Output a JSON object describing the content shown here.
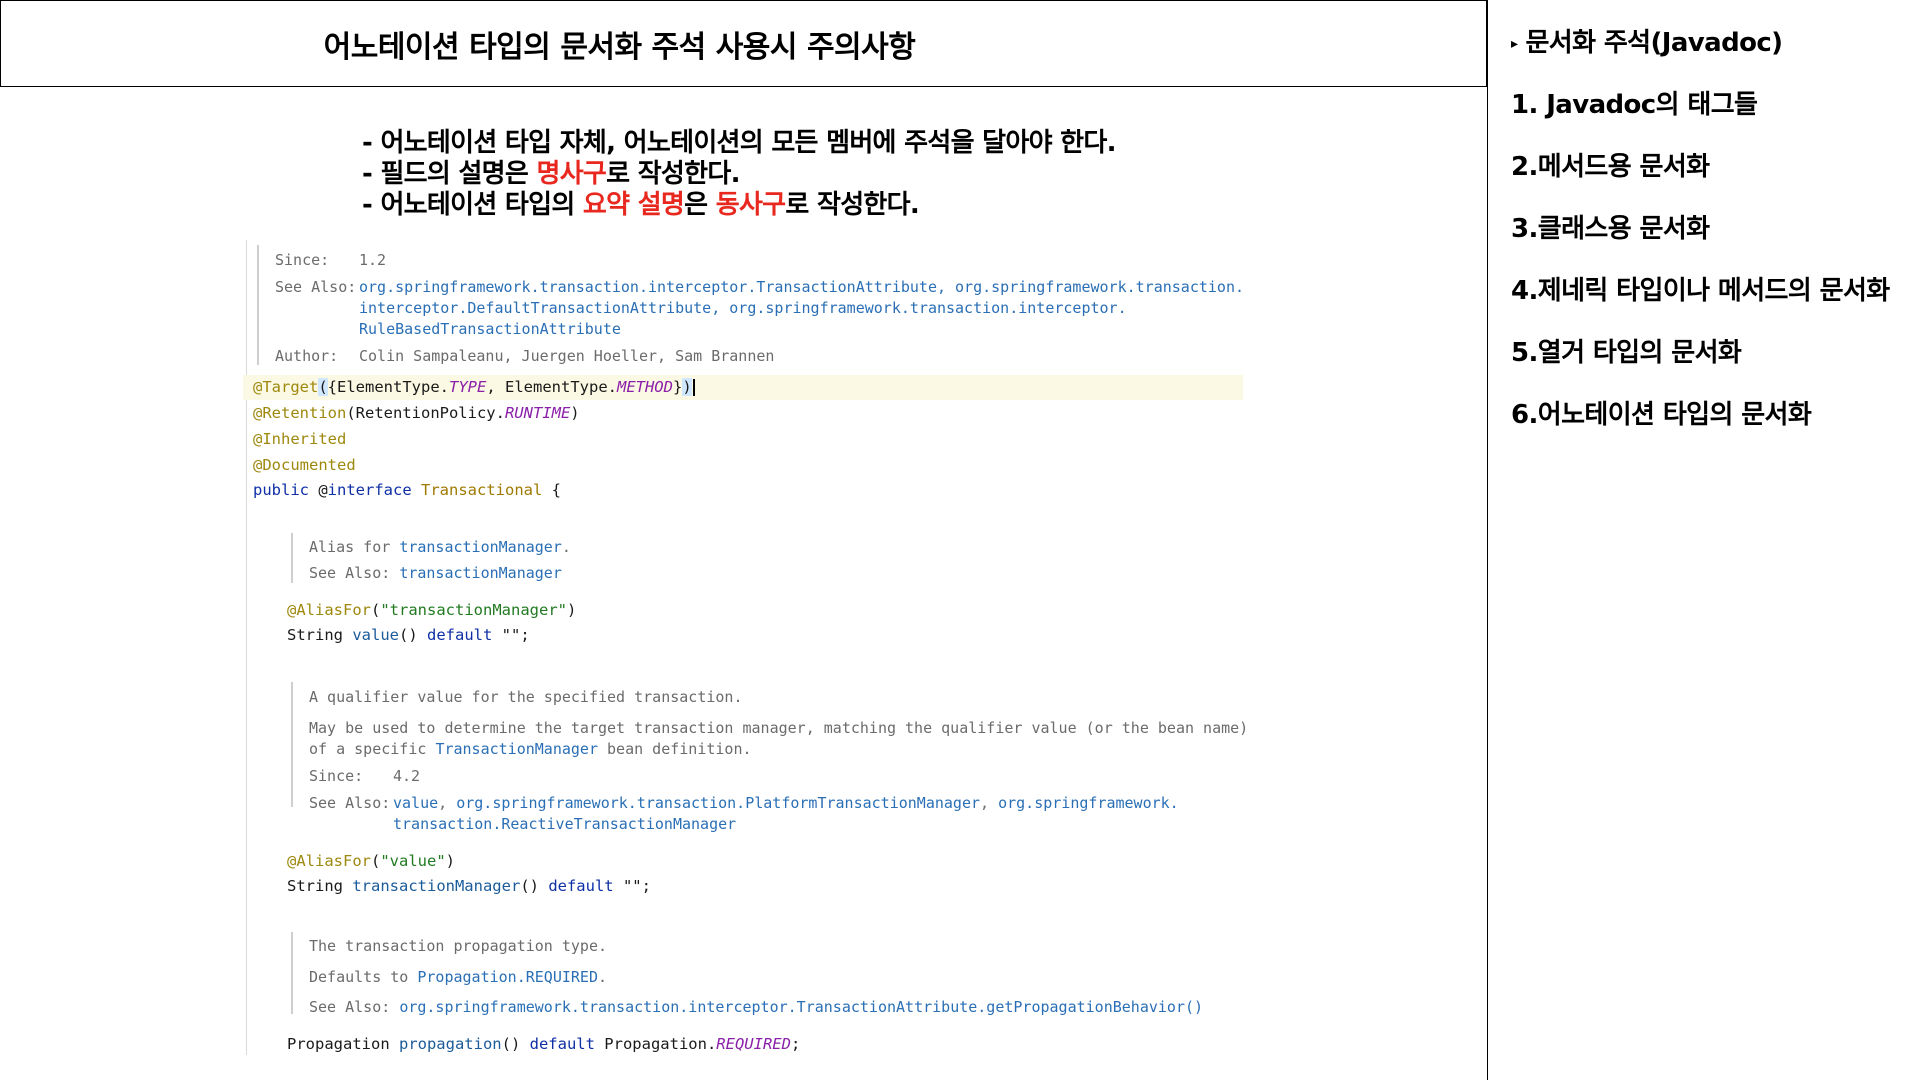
{
  "title": "어노테이션 타입의 문서화 주석 사용시 주의사항",
  "sidebar": {
    "items": [
      {
        "bullet": "▸",
        "label": "문서화 주석(Javadoc)"
      },
      {
        "label": "1. Javadoc의 태그들"
      },
      {
        "label": "2.메서드용 문서화"
      },
      {
        "label": "3.클래스용 문서화"
      },
      {
        "label": "4.제네릭 타입이나 메서드의 문서화"
      },
      {
        "label": "5.열거 타입의 문서화"
      },
      {
        "label": "6.어노테이션 타입의 문서화"
      }
    ]
  },
  "notes": {
    "line1": "- 어노테이션 타입 자체, 어노테이션의 모든 멤버에 주석을 달아야 한다.",
    "line2_a": "- 필드의 설명은 ",
    "line2_b": "명사구",
    "line2_c": "로 작성한다.",
    "line3_a": "- 어노테이션 타입의 ",
    "line3_b": "요약 설명",
    "line3_c": "은 ",
    "line3_d": "동사구",
    "line3_e": "로 작성한다.",
    "accent_color": "#e8281e"
  },
  "code": {
    "top_doc": {
      "since_label": "Since:",
      "since_value": "1.2",
      "see_label": "See Also:",
      "see_line1": "org.springframework.transaction.interceptor.TransactionAttribute, org.springframework.transaction.",
      "see_line2": "interceptor.DefaultTransactionAttribute, org.springframework.transaction.interceptor.",
      "see_line3": "RuleBasedTransactionAttribute",
      "author_label": "Author:",
      "author_value": "Colin Sampaleanu, Juergen Hoeller, Sam Brannen"
    },
    "target": {
      "anno": "@Target",
      "open": "(",
      "brace_open": "{",
      "et1": "ElementType.",
      "c1": "TYPE",
      "sep": ", ",
      "et2": "ElementType.",
      "c2": "METHOD",
      "brace_close": "}",
      "close": ")"
    },
    "retention": {
      "anno": "@Retention",
      "pre": "(RetentionPolicy.",
      "c": "RUNTIME",
      "post": ")"
    },
    "inherited": "@Inherited",
    "documented": "@Documented",
    "decl": {
      "kw": "public",
      "at": " @",
      "iface": "interface",
      "name": "Transactional",
      "brace": " {"
    },
    "doc1": {
      "pre": "Alias for ",
      "link": "transactionManager",
      "post": ".",
      "see_label": "See Also:",
      "see_link": "transactionManager"
    },
    "alias1": {
      "anno": "@AliasFor",
      "open": "(",
      "str": "\"transactionManager\"",
      "close": ")"
    },
    "value_decl": {
      "type": "String ",
      "name": "value",
      "mid": "() ",
      "kw": "default",
      "tail": " \"\";"
    },
    "doc2": {
      "l1": "A qualifier value for the specified transaction.",
      "l2": "May be used to determine the target transaction manager, matching the qualifier value (or the bean name)",
      "l3_pre": "of a specific ",
      "l3_link": "TransactionManager",
      "l3_post": " bean definition.",
      "since_label": "Since:",
      "since_value": "4.2",
      "see_label": "See Also:",
      "see_l1_a": "value",
      "see_l1_sep": ", ",
      "see_l1_b": "org.springframework.transaction.PlatformTransactionManager",
      "see_l1_c": "org.springframework.",
      "see_l2": "transaction.ReactiveTransactionManager"
    },
    "alias2": {
      "anno": "@AliasFor",
      "open": "(",
      "str": "\"value\"",
      "close": ")"
    },
    "tm_decl": {
      "type": "String ",
      "name": "transactionManager",
      "mid": "() ",
      "kw": "default",
      "tail": " \"\";"
    },
    "doc3": {
      "l1": "The transaction propagation type.",
      "l2_pre": "Defaults to ",
      "l2_link": "Propagation.REQUIRED",
      "l2_post": ".",
      "see_label": "See Also:",
      "see_link": "org.springframework.transaction.interceptor.TransactionAttribute.getPropagationBehavior()"
    },
    "prop_decl": {
      "type": "Propagation ",
      "name": "propagation",
      "mid": "() ",
      "kw": "default",
      "post": " Propagation.",
      "c": "REQUIRED",
      "end": ";"
    }
  }
}
